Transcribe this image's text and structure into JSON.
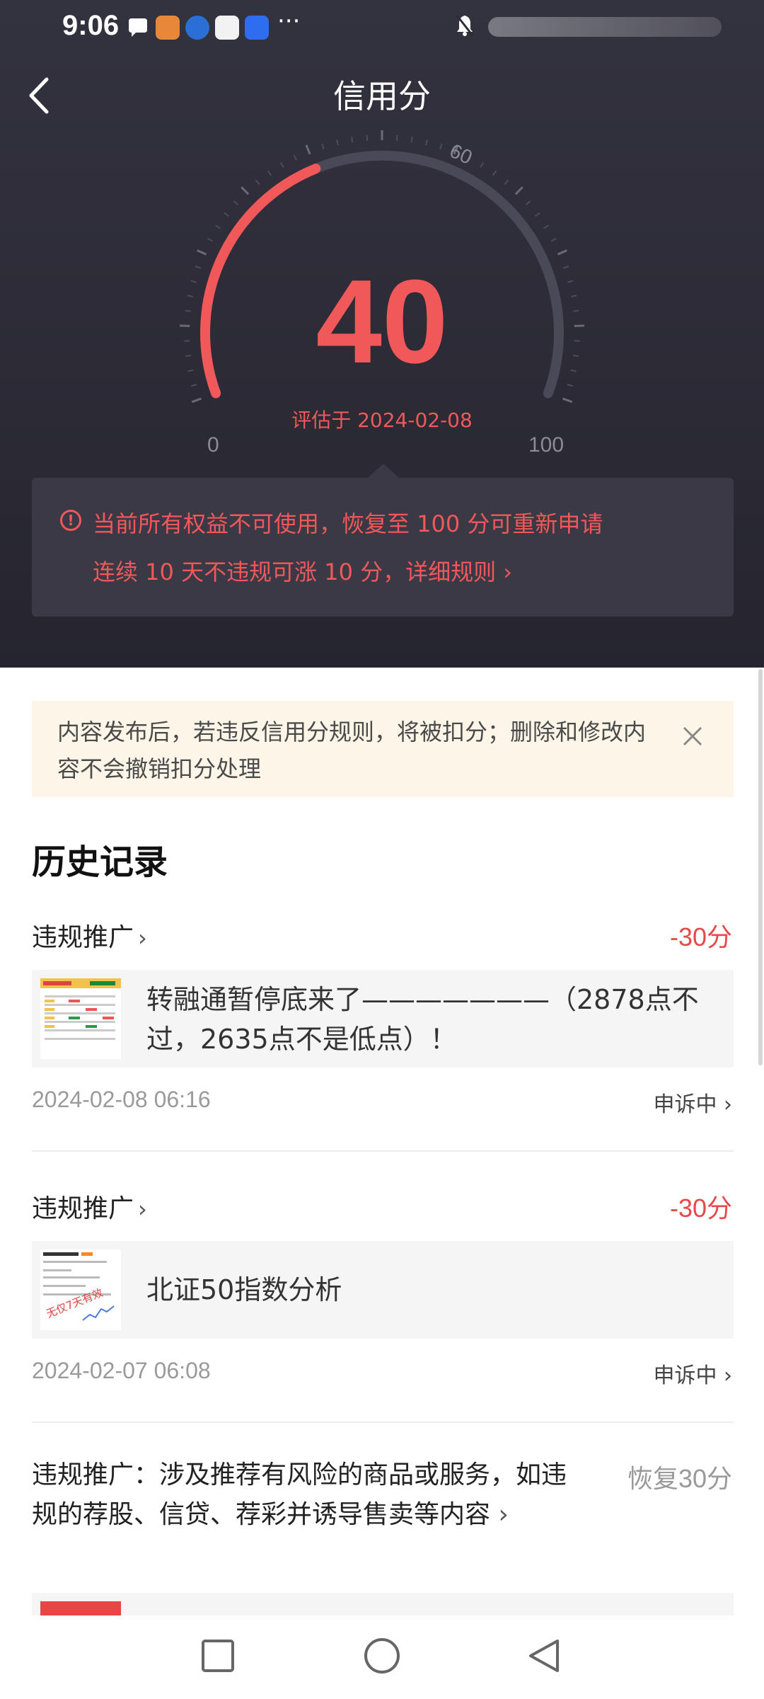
{
  "status_bar": {
    "time": "9:06",
    "more": "···"
  },
  "header": {
    "title": "信用分"
  },
  "gauge": {
    "score": "40",
    "evaluated": "评估于 2024-02-08",
    "tick_min": "0",
    "tick_mid": "60",
    "tick_max": "100",
    "range_max": 100,
    "score_value": 40
  },
  "notice": {
    "line1": "当前所有权益不可使用，恢复至 100 分可重新申请",
    "line2": "连续 10 天不违规可涨 10 分，详细规则 ›"
  },
  "tip": {
    "text": "内容发布后，若违反信用分规则，将被扣分；删除和修改内容不会撤销扣分处理"
  },
  "history": {
    "title": "历史记录",
    "records": [
      {
        "type": "违规推广",
        "score": "-30分",
        "content": "转融通暂停底来了———————（2878点不过，2635点不是低点）！",
        "date": "2024-02-08 06:16",
        "status": "申诉中"
      },
      {
        "type": "违规推广",
        "score": "-30分",
        "content": "北证50指数分析",
        "date": "2024-02-07 06:08",
        "status": "申诉中",
        "thumb_stamp": "无仅7天有效"
      },
      {
        "type": "违规推广：涉及推荐有风险的商品或服务，如违规的荐股、信贷、荐彩并诱导售卖等内容",
        "score": "恢复30分"
      }
    ]
  },
  "colors": {
    "accent": "#f0585a",
    "hero_bg": "#2c2b37",
    "tip_bg": "#fdf6e8"
  }
}
